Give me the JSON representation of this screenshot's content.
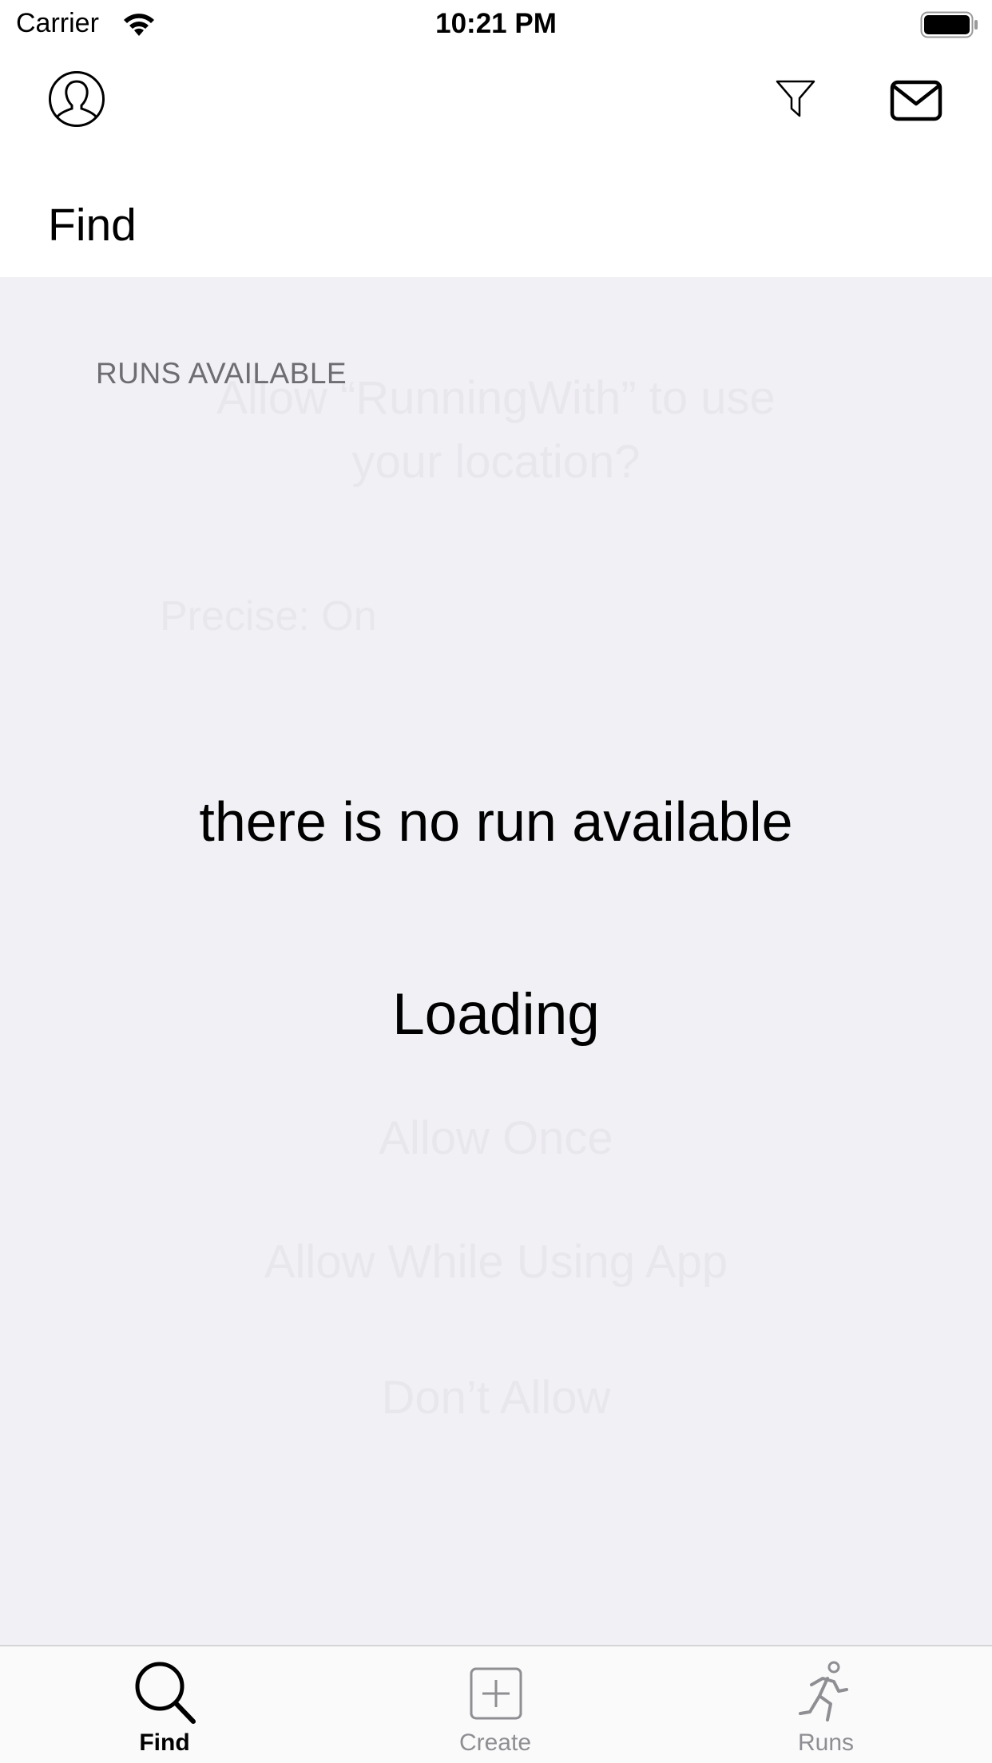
{
  "status_bar": {
    "carrier": "Carrier",
    "time": "10:21 PM"
  },
  "nav": {
    "title": "Find",
    "left_icon": "profile-icon",
    "right_icons": [
      "filter-icon",
      "mail-icon"
    ]
  },
  "content": {
    "section_header": "RUNS AVAILABLE",
    "empty_message": "there is no run available",
    "loading_text": "Loading",
    "ghost_alert": {
      "title_line1": "Allow “RunningWith” to use",
      "title_line2": "your location?",
      "precise": "Precise: On",
      "allow_once": "Allow Once",
      "allow_while_using": "Allow While Using App",
      "dont_allow": "Don’t Allow"
    }
  },
  "tab_bar": {
    "tabs": [
      {
        "label": "Find",
        "icon": "search-icon",
        "selected": true
      },
      {
        "label": "Create",
        "icon": "plus-square-icon",
        "selected": false
      },
      {
        "label": "Runs",
        "icon": "runner-icon",
        "selected": false
      }
    ]
  },
  "colors": {
    "content_background": "#f1f0f5",
    "section_header": "#6d6d72",
    "tab_inactive": "#8e8e93",
    "tab_active": "#000000"
  }
}
